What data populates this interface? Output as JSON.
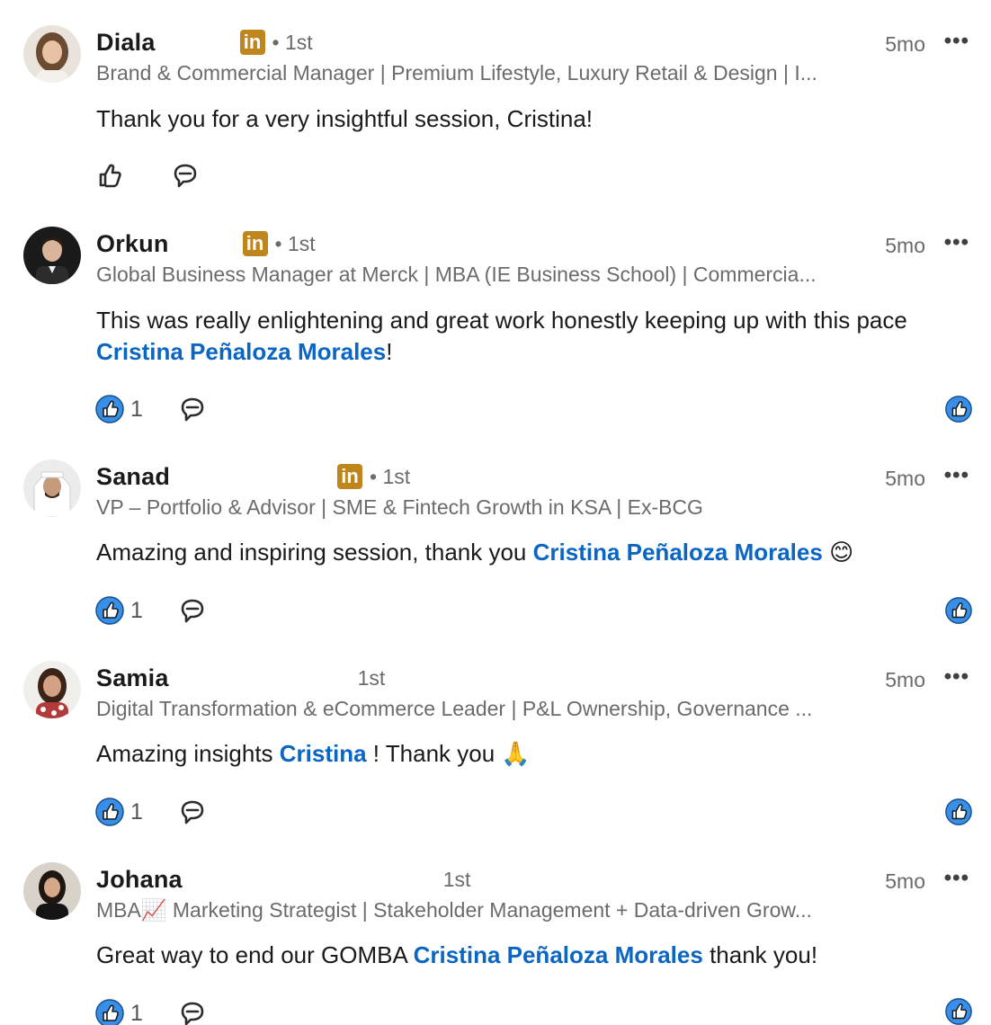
{
  "comments": [
    {
      "name": "Diala",
      "degree": "• 1st",
      "show_badge": true,
      "time": "5mo",
      "headline": "Brand & Commercial Manager | Premium Lifestyle, Luxury Retail & Design | I...",
      "body_pre": "Thank you for a very insightful session, Cristina!",
      "mention": "",
      "body_post": "",
      "likes": "",
      "liked": false
    },
    {
      "name": "Orkun",
      "degree": "• 1st",
      "show_badge": true,
      "time": "5mo",
      "headline": "Global Business Manager at Merck | MBA (IE Business School) | Commercia...",
      "body_pre": "This was really enlightening and great work honestly keeping up with this pace ",
      "mention": "Cristina Peñaloza Morales",
      "body_post": "!",
      "likes": "1",
      "liked": true
    },
    {
      "name": "Sanad",
      "degree": "• 1st",
      "show_badge": true,
      "time": "5mo",
      "headline": "VP – Portfolio & Advisor | SME & Fintech Growth in KSA | Ex-BCG",
      "body_pre": "Amazing and inspiring session, thank you ",
      "mention": "Cristina Peñaloza Morales",
      "body_post": " 😊",
      "likes": "1",
      "liked": true
    },
    {
      "name": "Samia",
      "degree": "1st",
      "show_badge": false,
      "time": "5mo",
      "headline": "Digital Transformation & eCommerce Leader | P&L Ownership, Governance ...",
      "body_pre": "Amazing insights ",
      "mention": "Cristina",
      "body_post": " ! Thank you 🙏",
      "likes": "1",
      "liked": true
    },
    {
      "name": "Johana",
      "degree": "1st",
      "show_badge": false,
      "time": "5mo",
      "headline": "MBA📈 Marketing Strategist | Stakeholder Management + Data-driven Grow...",
      "body_pre": "Great way to end our GOMBA ",
      "mention": "Cristina Peñaloza Morales",
      "body_post": " thank you!",
      "likes": "1",
      "liked": true
    }
  ],
  "badge_text": "in",
  "more_glyph": "•••",
  "colors": {
    "mention": "#0a66c2",
    "badge": "#c0861e",
    "muted": "#6b6b6b",
    "like_blue": "#378fe9"
  }
}
